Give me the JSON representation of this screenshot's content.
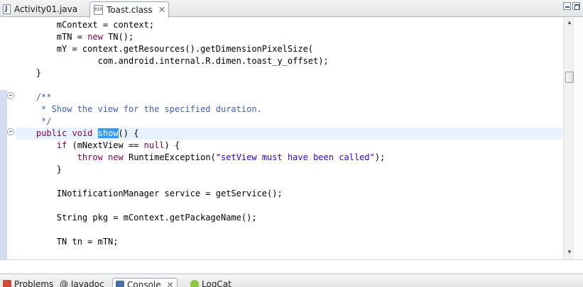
{
  "editor_tabs": [
    {
      "label": "Activity01.java",
      "icon": "java-file-icon"
    },
    {
      "label": "Toast.class",
      "icon": "class-file-icon",
      "active": true,
      "close": "✕"
    }
  ],
  "code": {
    "l1": {
      "a": "        mContext = context;"
    },
    "l2": {
      "a": "        mTN = ",
      "b": "new",
      "c": " TN();"
    },
    "l3": {
      "a": "        mY = context.getResources().getDimensionPixelSize("
    },
    "l4": {
      "a": "                com.android.internal.R.dimen.toast_y_offset);"
    },
    "l5": {
      "a": "    }"
    },
    "l6": {
      "a": ""
    },
    "l7": {
      "a": "    /**"
    },
    "l8": {
      "a": "     * Show the view for the specified duration."
    },
    "l9": {
      "a": "     */"
    },
    "l10": {
      "a": "public",
      "b": " ",
      "c": "void",
      "d": " ",
      "e": "show",
      "f": "() {"
    },
    "l11": {
      "a": "        ",
      "b": "if",
      "c": " (mNextView == ",
      "d": "null",
      "e": ") {"
    },
    "l12": {
      "a": "            ",
      "b": "throw",
      "c": " ",
      "d": "new",
      "e": " RuntimeException(",
      "f": "\"setView must have been called\"",
      "g": ");"
    },
    "l13": {
      "a": "        }"
    },
    "l14": {
      "a": ""
    },
    "l15": {
      "a": "        INotificationManager service = getService();"
    },
    "l16": {
      "a": ""
    },
    "l17": {
      "a": "        String pkg = mContext.getPackageName();"
    },
    "l18": {
      "a": ""
    },
    "l19": {
      "a": "        TN tn = mTN;"
    }
  },
  "bottom_tabs": [
    {
      "label": "Problems",
      "icon": "problems-icon"
    },
    {
      "label": "@ Javadoc",
      "icon": "javadoc-icon"
    },
    {
      "label": "Console",
      "icon": "console-icon",
      "active": true,
      "close": "✕"
    },
    {
      "label": "LogCat",
      "icon": "android-icon"
    }
  ],
  "colors": {
    "keyword": "#7f0055",
    "comment": "#3f5fbf",
    "string": "#2a00ff",
    "current_line": "#e8f2fe",
    "selection": "#3399ff"
  }
}
